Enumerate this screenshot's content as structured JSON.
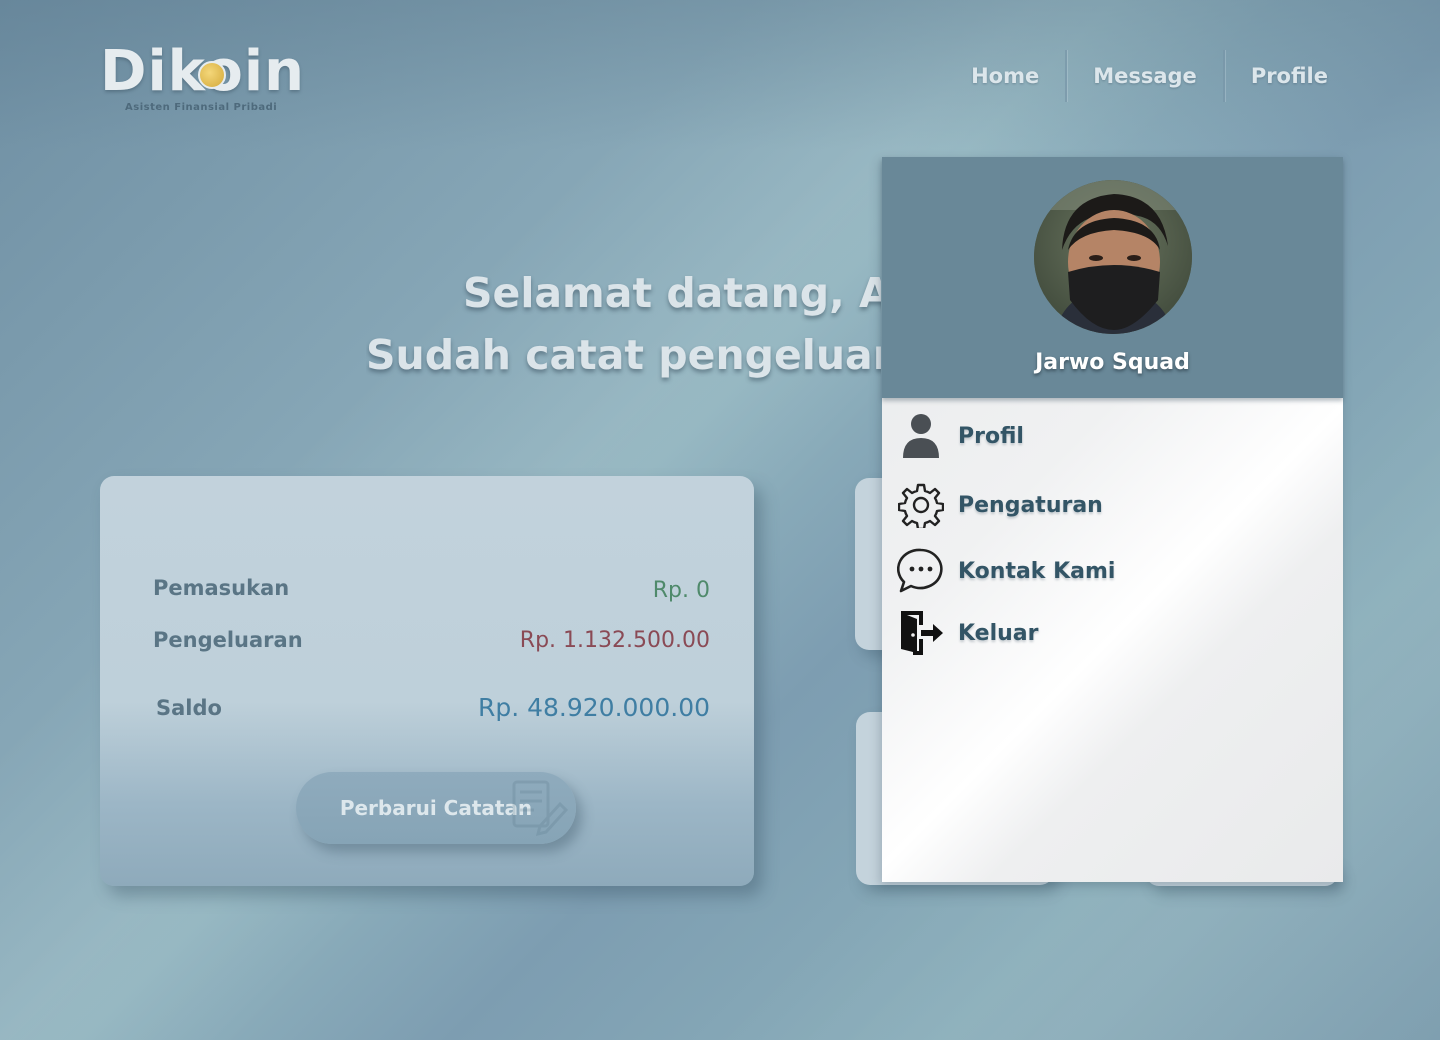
{
  "brand": {
    "name": "Dikoin",
    "tagline": "Asisten Finansial Pribadi"
  },
  "nav": {
    "items": [
      "Home",
      "Message",
      "Profile"
    ]
  },
  "welcome": {
    "line1": "Selamat datang, Ar",
    "line2": "Sudah catat pengeluaran"
  },
  "summary": {
    "income_label": "Pemasukan",
    "income_value": "Rp.  0",
    "expense_label": "Pengeluaran",
    "expense_value": "Rp. 1.132.500.00",
    "balance_label": "Saldo",
    "balance_value": "Rp. 48.920.000.00",
    "update_button": "Perbarui Catatan"
  },
  "colors": {
    "income": "#4f8a6b",
    "expense": "#8a4a55",
    "balance": "#3f7ea3",
    "panel_header": "#698898"
  },
  "profile_menu": {
    "user_name": "Jarwo Squad",
    "items": [
      {
        "label": "Profil",
        "icon": "user-icon"
      },
      {
        "label": "Pengaturan",
        "icon": "gear-icon"
      },
      {
        "label": "Kontak Kami",
        "icon": "chat-icon"
      },
      {
        "label": "Keluar",
        "icon": "logout-icon"
      }
    ]
  }
}
